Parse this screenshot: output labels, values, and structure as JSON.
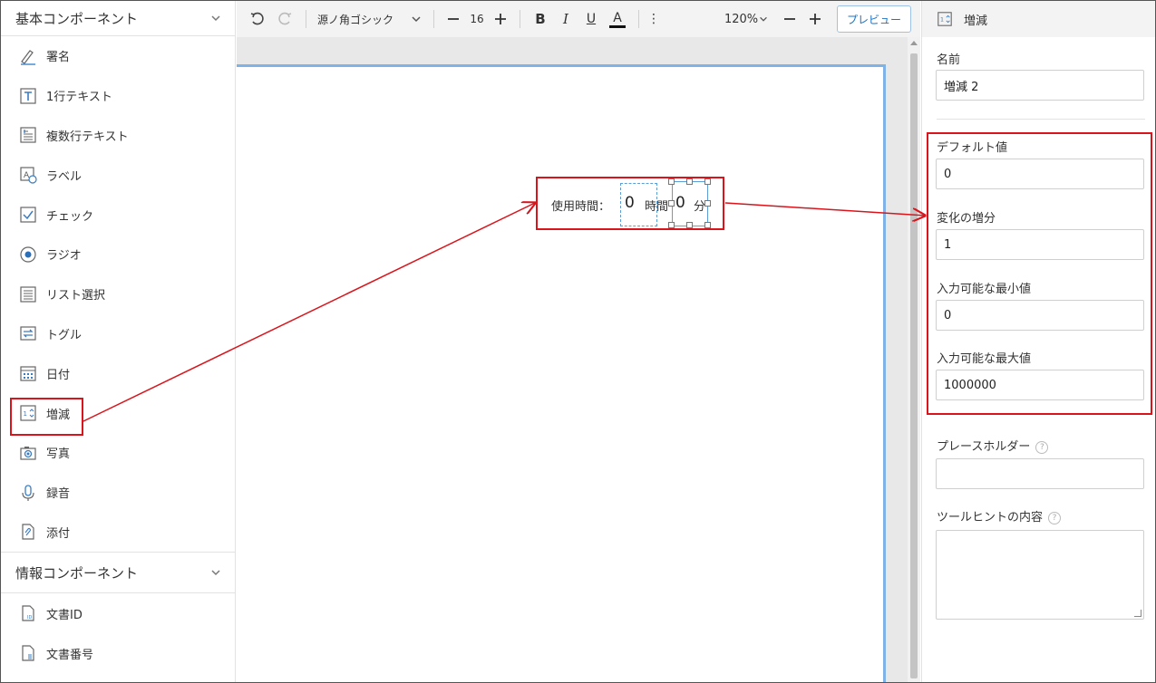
{
  "sidebar": {
    "group1_title": "基本コンポーネント",
    "items": [
      {
        "label": "署名",
        "icon": "signature-icon"
      },
      {
        "label": "1行テキスト",
        "icon": "text-t-icon"
      },
      {
        "label": "複数行テキスト",
        "icon": "multiline-text-icon"
      },
      {
        "label": "ラベル",
        "icon": "label-icon"
      },
      {
        "label": "チェック",
        "icon": "checkbox-icon"
      },
      {
        "label": "ラジオ",
        "icon": "radio-icon"
      },
      {
        "label": "リスト選択",
        "icon": "list-icon"
      },
      {
        "label": "トグル",
        "icon": "toggle-icon"
      },
      {
        "label": "日付",
        "icon": "calendar-icon"
      },
      {
        "label": "増減",
        "icon": "stepper-icon"
      },
      {
        "label": "写真",
        "icon": "camera-icon"
      },
      {
        "label": "録音",
        "icon": "microphone-icon"
      },
      {
        "label": "添付",
        "icon": "attachment-icon"
      }
    ],
    "group2_title": "情報コンポーネント",
    "info_items": [
      {
        "label": "文書ID",
        "icon": "document-id-icon"
      },
      {
        "label": "文書番号",
        "icon": "document-number-icon"
      }
    ]
  },
  "toolbar": {
    "font_name": "源ノ角ゴシック",
    "font_size": "16",
    "bold": "B",
    "italic": "I",
    "underline": "U",
    "font_color": "A",
    "more": "⋮",
    "zoom": "120%",
    "preview": "プレビュー"
  },
  "canvas": {
    "widget_label": "使用時間：",
    "hours_value": "0",
    "hours_unit": "時間",
    "minutes_value": "0",
    "minutes_unit": "分"
  },
  "panel": {
    "title": "増減",
    "name_label": "名前",
    "name_value": "増減 2",
    "default_label": "デフォルト値",
    "default_value": "0",
    "step_label": "変化の増分",
    "step_value": "1",
    "min_label": "入力可能な最小値",
    "min_value": "0",
    "max_label": "入力可能な最大値",
    "max_value": "1000000",
    "placeholder_label": "プレースホルダー",
    "placeholder_value": "",
    "tooltip_label": "ツールヒントの内容",
    "help_glyph": "?"
  },
  "colors": {
    "highlight": "#d9141b",
    "accent": "#1a73c8",
    "selection": "#5b9fd6"
  }
}
